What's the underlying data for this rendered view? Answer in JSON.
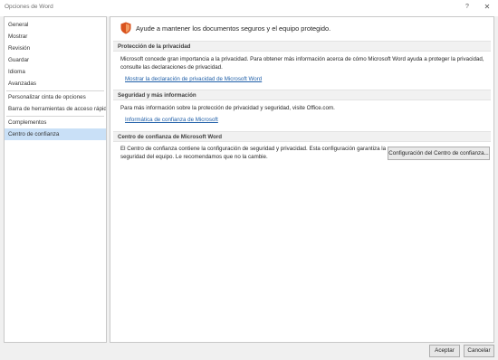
{
  "window": {
    "title": "Opciones de Word",
    "help_glyph": "?",
    "close_glyph": "✕"
  },
  "sidebar": {
    "items": [
      {
        "label": "General"
      },
      {
        "label": "Mostrar"
      },
      {
        "label": "Revisión"
      },
      {
        "label": "Guardar"
      },
      {
        "label": "Idioma"
      },
      {
        "label": "Avanzadas"
      },
      {
        "label": "Personalizar cinta de opciones"
      },
      {
        "label": "Barra de herramientas de acceso rápido"
      },
      {
        "label": "Complementos"
      },
      {
        "label": "Centro de confianza"
      }
    ],
    "selected": "Centro de confianza",
    "selected_color": "#c9e0f7"
  },
  "main": {
    "header": "Ayude a mantener los documentos seguros y el equipo protegido.",
    "header_icon": "shield-icon",
    "accent_color": "#d9531e",
    "privacy": {
      "title": "Protección de la privacidad",
      "text_line1": "Microsoft concede gran importancia a la privacidad. Para obtener más información acerca de cómo Microsoft Word ayuda a proteger la privacidad,",
      "text_line2": "consulte las declaraciones de privacidad.",
      "link": "Mostrar la declaración de privacidad de Microsoft Word"
    },
    "security": {
      "title": "Seguridad y más información",
      "text": "Para más información sobre la protección de privacidad y seguridad, visite Office.com.",
      "link": "Informática de confianza de Microsoft"
    },
    "trust_center": {
      "title": "Centro de confianza de Microsoft Word",
      "text_line1": "El Centro de confianza contiene la configuración de seguridad y privacidad. Esta configuración garantiza la",
      "text_line2": "seguridad del equipo. Le recomendamos que no la cambie.",
      "button": "Configuración del Centro de confianza..."
    }
  },
  "footer": {
    "accept": "Aceptar",
    "cancel": "Cancelar"
  }
}
